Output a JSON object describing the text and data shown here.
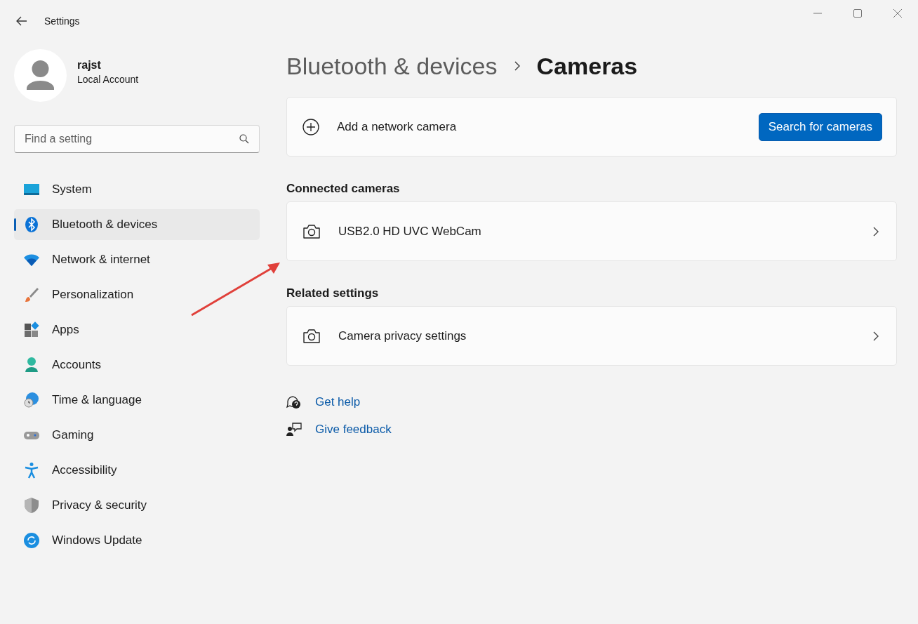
{
  "window": {
    "title": "Settings"
  },
  "account": {
    "name": "rajst",
    "type": "Local Account"
  },
  "search": {
    "placeholder": "Find a setting"
  },
  "nav": [
    {
      "label": "System",
      "kind": "system",
      "selected": false
    },
    {
      "label": "Bluetooth & devices",
      "kind": "bluetooth",
      "selected": true
    },
    {
      "label": "Network & internet",
      "kind": "network",
      "selected": false
    },
    {
      "label": "Personalization",
      "kind": "brush",
      "selected": false
    },
    {
      "label": "Apps",
      "kind": "apps",
      "selected": false
    },
    {
      "label": "Accounts",
      "kind": "accounts",
      "selected": false
    },
    {
      "label": "Time & language",
      "kind": "time",
      "selected": false
    },
    {
      "label": "Gaming",
      "kind": "gaming",
      "selected": false
    },
    {
      "label": "Accessibility",
      "kind": "accessibility",
      "selected": false
    },
    {
      "label": "Privacy & security",
      "kind": "privacy",
      "selected": false
    },
    {
      "label": "Windows Update",
      "kind": "update",
      "selected": false
    }
  ],
  "breadcrumb": {
    "parent": "Bluetooth & devices",
    "current": "Cameras"
  },
  "add_camera": {
    "label": "Add a network camera",
    "button": "Search for cameras"
  },
  "sections": [
    {
      "heading": "Connected cameras",
      "items": [
        {
          "label": "USB2.0 HD UVC WebCam"
        }
      ]
    },
    {
      "heading": "Related settings",
      "items": [
        {
          "label": "Camera privacy settings"
        }
      ]
    }
  ],
  "help_links": [
    {
      "label": "Get help",
      "kind": "help"
    },
    {
      "label": "Give feedback",
      "kind": "feedback"
    }
  ]
}
